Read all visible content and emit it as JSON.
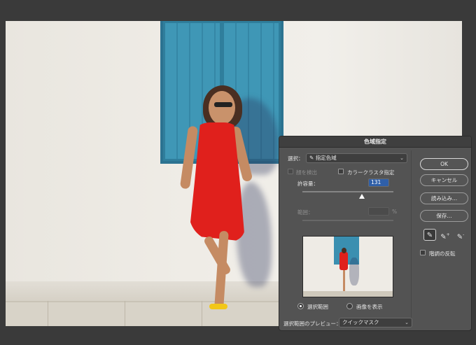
{
  "dialog": {
    "title": "色域指定",
    "select_label": "選択：",
    "select_value": "指定色域",
    "localized_clusters_label": "顔を検出",
    "color_cluster_label": "カラークラスタ指定",
    "fuzziness_label": "許容量：",
    "fuzziness_value": "131",
    "range_label": "範囲：",
    "range_unit": "%",
    "preview_option_selection": "選択範囲",
    "preview_option_image": "画像を表示",
    "selection_preview_label": "選択範囲のプレビュー：",
    "selection_preview_value": "クイックマスク",
    "invert_label": "階調の反転",
    "buttons": {
      "ok": "OK",
      "cancel": "キャンセル",
      "load": "読み込み...",
      "save": "保存..."
    },
    "eyedroppers": [
      "eyedropper-icon",
      "eyedropper-plus-icon",
      "eyedropper-minus-icon"
    ]
  }
}
